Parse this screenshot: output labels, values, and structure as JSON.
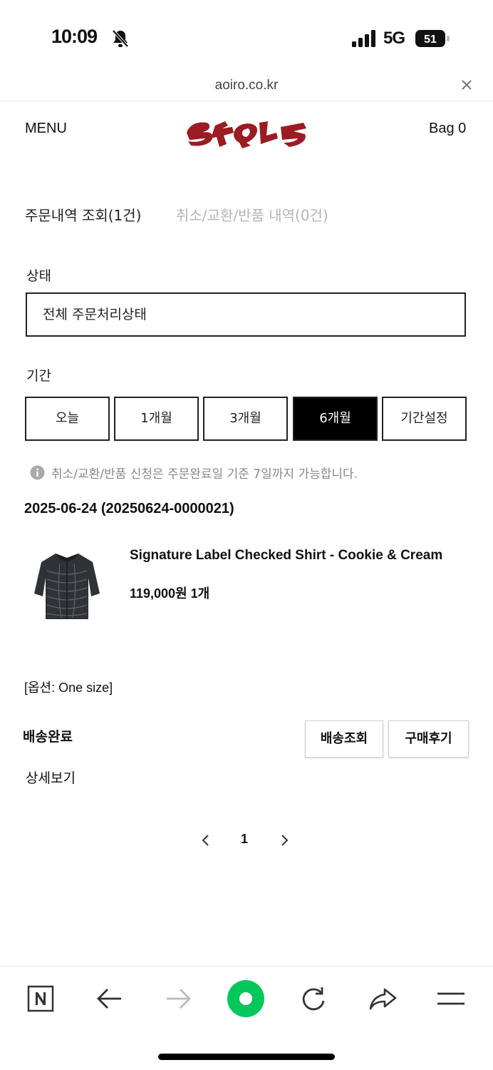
{
  "status_bar": {
    "time": "10:09",
    "network": "5G",
    "battery": "51"
  },
  "url_bar": {
    "domain": "aoiro.co.kr"
  },
  "header": {
    "menu_label": "MENU",
    "bag_label": "Bag 0",
    "logo_color": "#9b1c22"
  },
  "tabs": {
    "orders": "주문내역 조회(1건)",
    "cancel": "취소/교환/반품 내역(0건)"
  },
  "filters": {
    "status_label": "상태",
    "status_value": "전체 주문처리상태",
    "period_label": "기간",
    "periods": [
      "오늘",
      "1개월",
      "3개월",
      "6개월",
      "기간설정"
    ],
    "active_period": "6개월"
  },
  "notice": "취소/교환/반품 신청은 주문완료일 기준 7일까지 가능합니다.",
  "order": {
    "date_number": "2025-06-24 (20250624-0000021)",
    "product_name": "Signature Label Checked Shirt - Cookie & Cream",
    "price_qty": "119,000원 1개",
    "option": "[옵션: One size]",
    "status": "배송완료",
    "tracking_button": "배송조회",
    "review_button": "구매후기",
    "detail_link": "상세보기"
  },
  "pagination": {
    "current_page": "1"
  },
  "toolbar": {
    "accent_color": "#03c75a"
  }
}
